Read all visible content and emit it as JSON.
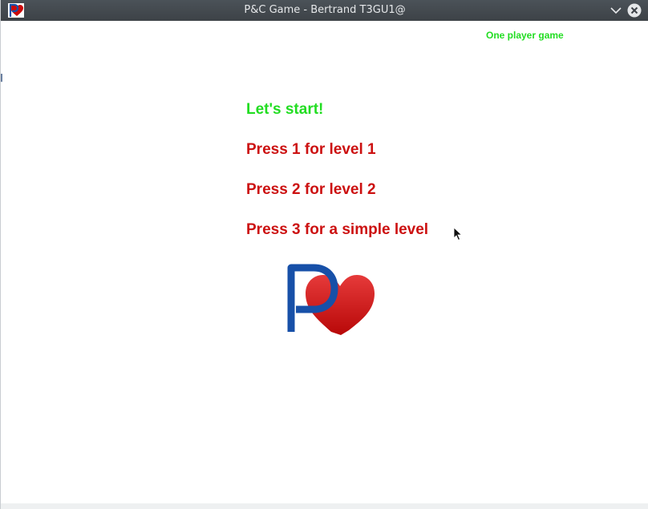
{
  "window": {
    "title": "P&C Game - Bertrand T3GU1@"
  },
  "game": {
    "mode_label": "One player game",
    "greeting": "Let's start!",
    "options": [
      "Press 1 for level 1",
      "Press 2 for level 2",
      "Press 3 for a simple level"
    ]
  },
  "colors": {
    "titlebar": "#3d4247",
    "green_text": "#22dd22",
    "red_text": "#cc1111",
    "logo_blue": "#1750a8",
    "logo_red": "#cc0a0a"
  },
  "icons": {
    "app": "heart-logo-icon",
    "minimize": "chevron-down-icon",
    "close": "close-icon",
    "logo": "p-heart-logo-icon"
  }
}
